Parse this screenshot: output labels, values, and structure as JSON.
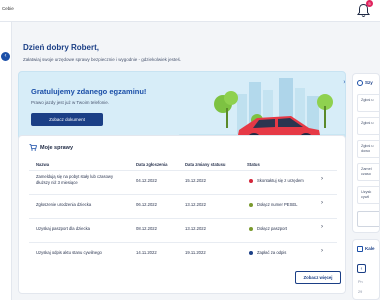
{
  "app": {
    "name": "Cebie",
    "notifications_count": "5"
  },
  "greeting": {
    "title": "Dzień dobry Robert,",
    "subtitle": "Załatwiaj swoje urzędowe sprawy bezpiecznie i wygodnie - gdziekolwiek jesteś."
  },
  "banner": {
    "title": "Gratulujemy zdanego egzaminu!",
    "subtitle": "Prawo jazdy jest już w Twoim telefonie.",
    "button_label": "Zobacz dokument",
    "close_glyph": "×"
  },
  "my_cases": {
    "title": "Moje sprawy",
    "columns": [
      "Nazwa",
      "Data zgłoszenia",
      "Data zmiany statusu",
      "Status"
    ],
    "rows": [
      {
        "name_line1": "Zameldują się na pobyt stały lub czasowy",
        "name_line2": "dłuższy niż 3 miesiące",
        "submitted": "04.12.2022",
        "changed": "15.12.2022",
        "status": "Skontaktuj się z urzędem",
        "status_color": "#d3263a"
      },
      {
        "name_line1": "Zgłoszenie urodzenia dziecka",
        "name_line2": "",
        "submitted": "06.12.2022",
        "changed": "13.12.2022",
        "status": "Dołącz numer PESEL",
        "status_color": "#7a9a2e"
      },
      {
        "name_line1": "Uzyskaj paszport dla dziecka",
        "name_line2": "",
        "submitted": "08.12.2022",
        "changed": "13.12.2022",
        "status": "Dołącz paszport",
        "status_color": "#7a9a2e"
      },
      {
        "name_line1": "Uzyskaj odpis aktu stanu cywilnego",
        "name_line2": "",
        "submitted": "14.11.2022",
        "changed": "19.11.2022",
        "status": "Zapłać za odpis",
        "status_color": "#1b3f86"
      }
    ],
    "more_button": "Zobacz więcej"
  },
  "right_panel": {
    "title": "Szy",
    "items": [
      {
        "line1": "Zgłoś u",
        "line2": ""
      },
      {
        "line1": "Zgłoś u",
        "line2": ""
      },
      {
        "line1": "Zgłoś u",
        "line2": "dowo"
      },
      {
        "line1": "Zamel",
        "line2": "czaso"
      },
      {
        "line1": "Uzysk",
        "line2": "cywil"
      }
    ]
  },
  "calendar": {
    "title": "Kale",
    "prev": "‹",
    "days": [
      "Pn",
      "29"
    ]
  },
  "icons": [
    "bell-icon",
    "chevron-left-icon",
    "cart-icon",
    "chevron-right-icon",
    "search-icon",
    "calendar-icon",
    "close-icon"
  ],
  "colors": {
    "primary": "#1b3f86",
    "accent": "#e0245e",
    "banner_bg": "#d7edf8",
    "car": "#e63946"
  }
}
